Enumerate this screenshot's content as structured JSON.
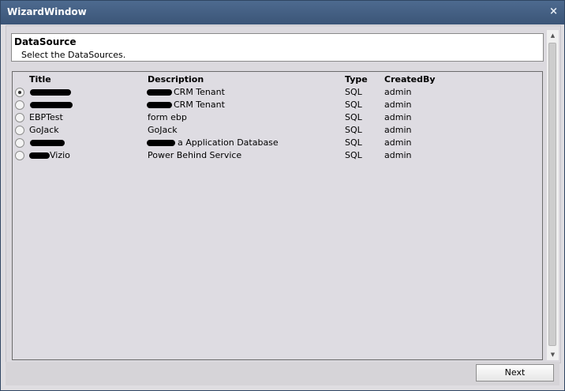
{
  "window": {
    "title": "WizardWindow",
    "close_glyph": "×"
  },
  "header": {
    "title": "DataSource",
    "subtitle": "Select the DataSources."
  },
  "columns": [
    "Title",
    "Description",
    "Type",
    "CreatedBy"
  ],
  "rows": [
    {
      "title": "",
      "description": "CRM Tenant",
      "type": "SQL",
      "created_by": "admin",
      "selected": true
    },
    {
      "title": "",
      "description": "CRM Tenant",
      "type": "SQL",
      "created_by": "admin",
      "selected": false
    },
    {
      "title": "EBPTest",
      "description": "form ebp",
      "type": "SQL",
      "created_by": "admin",
      "selected": false
    },
    {
      "title": "GoJack",
      "description": "GoJack",
      "type": "SQL",
      "created_by": "admin",
      "selected": false
    },
    {
      "title": "",
      "description": "a Application Database",
      "type": "SQL",
      "created_by": "admin",
      "selected": false
    },
    {
      "title": "Vizio",
      "description": "Power Behind Service",
      "type": "SQL",
      "created_by": "admin",
      "selected": false
    }
  ],
  "footer": {
    "next_label": "Next"
  },
  "icons": {
    "close": "close-icon",
    "scroll_up": "scroll-up-icon",
    "scroll_down": "scroll-down-icon"
  }
}
